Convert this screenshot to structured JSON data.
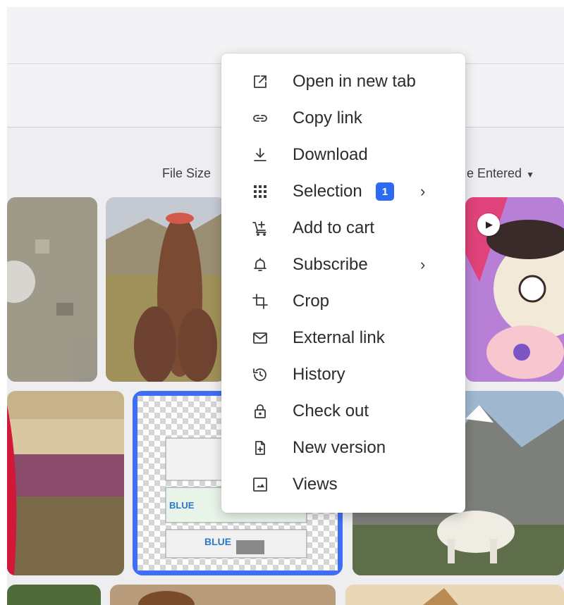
{
  "sort": {
    "left_label": "File Size",
    "right_label": "e Entered"
  },
  "accent_color": "#3d6ef5",
  "menu": {
    "items": [
      {
        "label": "Open in new tab",
        "icon": "open-in-new-tab-icon"
      },
      {
        "label": "Copy link",
        "icon": "link-icon"
      },
      {
        "label": "Download",
        "icon": "download-icon"
      },
      {
        "label": "Selection",
        "icon": "grid-icon",
        "badge": "1",
        "submenu": true
      },
      {
        "label": "Add to cart",
        "icon": "add-to-cart-icon"
      },
      {
        "label": "Subscribe",
        "icon": "bell-icon",
        "submenu": true
      },
      {
        "label": "Crop",
        "icon": "crop-icon"
      },
      {
        "label": "External link",
        "icon": "envelope-icon"
      },
      {
        "label": "History",
        "icon": "history-icon"
      },
      {
        "label": "Check out",
        "icon": "lock-icon"
      },
      {
        "label": "New version",
        "icon": "file-plus-icon"
      },
      {
        "label": "Views",
        "icon": "image-icon"
      }
    ]
  }
}
